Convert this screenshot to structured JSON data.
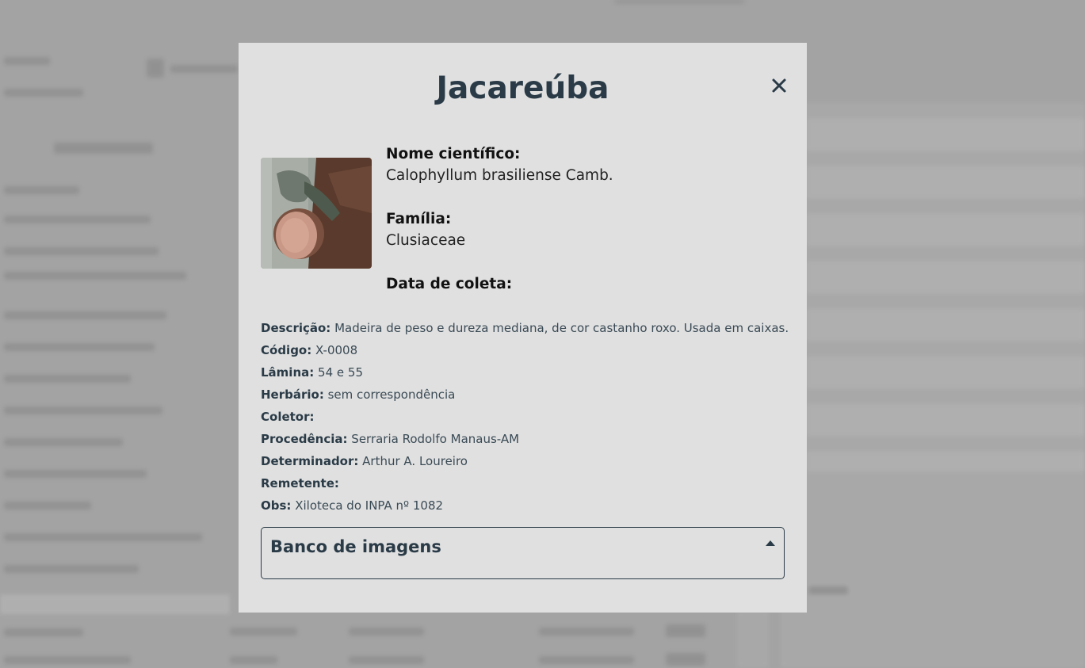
{
  "modal": {
    "title": "Jacareúba",
    "close_icon": "close-icon",
    "image_alt": "bark-photo",
    "fields": [
      {
        "label": "Nome científico:",
        "value": "Calophyllum brasiliense Camb."
      },
      {
        "label": "Família:",
        "value": "Clusiaceae"
      },
      {
        "label": "Data de coleta:",
        "value": ""
      }
    ],
    "details": [
      {
        "label": "Descrição:",
        "value": "Madeira de peso e dureza mediana, de cor castanho roxo. Usada em caixas."
      },
      {
        "label": "Código:",
        "value": "X-0008"
      },
      {
        "label": "Lâmina:",
        "value": "54 e 55"
      },
      {
        "label": "Herbário:",
        "value": "sem correspondência"
      },
      {
        "label": "Coletor:",
        "value": ""
      },
      {
        "label": "Procedência:",
        "value": "Serraria Rodolfo Manaus-AM"
      },
      {
        "label": "Determinador:",
        "value": "Arthur A. Loureiro"
      },
      {
        "label": "Remetente:",
        "value": ""
      },
      {
        "label": "Obs:",
        "value": "Xiloteca do INPA nº 1082"
      }
    ],
    "accordion": {
      "title": "Banco de imagens",
      "icon": "caret-up-icon"
    }
  },
  "colors": {
    "overlay": "#a3a3a3",
    "modal_bg": "#e0e0e0",
    "title": "#2a3b47"
  }
}
